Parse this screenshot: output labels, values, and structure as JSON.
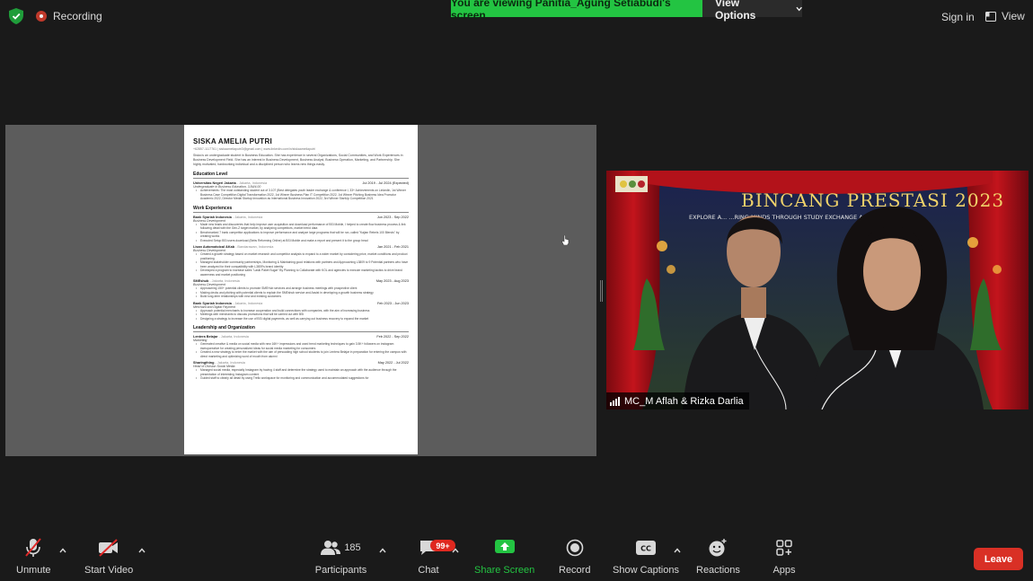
{
  "topbar": {
    "recording": "Recording",
    "viewing_banner": "You are viewing Panitia_Agung Setiabudi's screen",
    "view_options": "View Options",
    "sign_in": "Sign in",
    "view": "View"
  },
  "shared_doc": {
    "name": "SISKA AMELIA PUTRI",
    "contact": "+62857-1117761 | siskaameliaputri3@gmail.com | www.linkedin.com/in/siskaameliaputri",
    "summary": "Siska is an undergraduate student in Business Education. She has experience in several Organizations, Social Communities, and Work Experiences in Business Development Field. She has an interest in Business Development, Business Analyst, Business Operation, Marketing, and Partnership. She highly motivated, hardworking individual and a disciplined person who learns new things easily.",
    "sections": [
      {
        "title": "Education Level",
        "entries": [
          {
            "org": "Universitas Negeri Jakarta",
            "loc": " - Jakarta, Indonesia",
            "date": "Jul 2019 - Jul 2024 (Expected)",
            "role": "Undergraduate in Business Education, 3.84/4.00",
            "bullets": [
              "Achievements: The most outstanding student out of 3.107 (Best delegates youth leader exchange & conference I, 33+ Achievements on LinkedIn, 1st Winner Business Case Competition Digital Transformation 2022, 1st Winner Business Plan IT Competition 2022, 1st Winner Pitching Business Idea Promotor Academic 2022, Director Medal Startup Innovation as International Business Innovation 2022, 3rd Winner StartUp Competition 2021"
            ]
          }
        ]
      },
      {
        "title": "Work Experiences",
        "entries": [
          {
            "org": "Bank Syariah Indonesia",
            "loc": " - Jakarta, Indonesia",
            "date": "Jun 2023 - Sep 2022",
            "role": "Business Development",
            "bullets": [
              "Made new leads and discoveries that help improve user acquisition and download performance of BSI Mobile, I helped to create flow business process & link following detail with the Gen-Z target market, by analyzing competitors, market trend data",
              "Benchmarked 7 bank competitor applications to improve performance and analyze large programs that will be run, called \"Kajian Rebels 100 Blends\" by creating works",
              "Executed Setup BSI users download (Bebs Reforming Online) at BSI Mobile and make a report and present it to the group head"
            ]
          },
          {
            "org": "Lisan Automotoical &Kab",
            "loc": " - Bandarawan, Indonesia",
            "date": "Jan 2021 - Feb 2021",
            "role": "Business Development",
            "bullets": [
              "Created a growth strategy based on market research and competitor analysis to expand to a wider market by considering price, market conditions and product positioning",
              "Managed stakeholder community partnerships, Monitoring & Maintaining good relations with partners and Approaching L3809 to 9 Potential partners who have been analyzed for their compatibility with L3809's brand identity",
              "Developed a program to increase sales \"Lasik Paket Sugar\" By Planning to Collaborate with KOL and agencies to execute marketing tactics to drive brand awareness and market positioning"
            ]
          },
          {
            "org": "SMEshub",
            "loc": " - Jakarta, Indonesia",
            "date": "May 2023 - Aug 2023",
            "role": "Business Development",
            "bullets": [
              "Approaching 150+ potential clients to promote SMEHub services and arrange business meetings with prospective client",
              "Making decks and pitching with potential clients to explain the SMEshub service and Assist in developing a growth business strategy",
              "Build long-term relationships with new and existing customers"
            ]
          },
          {
            "org": "Bank Syariah Indonesia",
            "loc": " - Jakarta, Indonesia",
            "date": "Feb 2023 - Jun 2023",
            "role": "Merchant and Digital Payment",
            "bullets": [
              "Approach potential merchants to increase cooperation and build connections with companies, with the aim of increasing business",
              "Meetings with merchants to discuss promotions that will be carried out with BSI",
              "Designing a strategy to increase the use of BSI digital payments, as well as carrying out business recovery to expand the market"
            ]
          }
        ]
      },
      {
        "title": "Leadership and Organization",
        "entries": [
          {
            "org": "Lentera Belajar",
            "loc": " - Jakarta, Indonesia",
            "date": "Feb 2022 - Sep 2022",
            "role": "Marketing",
            "bullets": [
              "Generated creative & media on social media with new 16K+ impressions and used trend marketing techniques to gain 3.5K+ followers on instagram #weupcreative for creating personalized ideas for social media marketing for consumers",
              "Created a new strategy to enter the market with the aim of persuading high school students to join Lentera Belajar in preparation for entering the campus with direct marketing and optimizing word of mouth from alumni"
            ]
          },
          {
            "org": "Sharingthing",
            "loc": " - Jakarta, Indonesia",
            "date": "May 2022 - Jul 2022",
            "role": "Head of Division Social Media",
            "bullets": [
              "Managed social media, especially Instagram by having 4 staff and determine the strategy used to maintain an approach with the audience through the presentation of interesting Instagram content",
              "Guided staff to clearly all detail by using Trello workspace for monitoring and communication and accommodated suggestions for"
            ]
          }
        ]
      }
    ]
  },
  "video": {
    "participant_name": "MC_M Aflah & Rizka Darlia",
    "banner_title": "BINCANG PRESTASI 2023",
    "banner_subtitle": "EXPLORE A... ...RING MINDS THROUGH STUDY EXCHANGE A..."
  },
  "toolbar": {
    "unmute": "Unmute",
    "start_video": "Start Video",
    "participants": "Participants",
    "participant_count": "185",
    "chat": "Chat",
    "chat_badge": "99+",
    "share_screen": "Share Screen",
    "record": "Record",
    "show_captions": "Show Captions",
    "reactions": "Reactions",
    "apps": "Apps",
    "leave": "Leave",
    "cc_icon_text": "CC"
  },
  "colors": {
    "share_green": "#23c442",
    "leave_red": "#d93025",
    "badge_red": "#e0281f",
    "muted_red": "#e02828"
  }
}
